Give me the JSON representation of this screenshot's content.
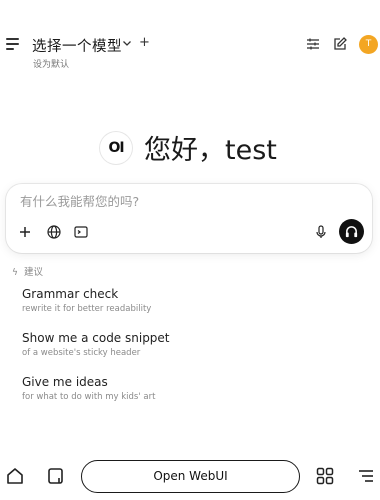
{
  "header": {
    "model_selector_label": "选择一个模型",
    "set_default_label": "设为默认",
    "avatar_initial": "T"
  },
  "greeting": {
    "logo_text": "OI",
    "text": "您好，test"
  },
  "composer": {
    "placeholder": "有什么我能帮您的吗?"
  },
  "suggestions": {
    "header": "建议",
    "items": [
      {
        "title": "Grammar check",
        "subtitle": "rewrite it for better readability"
      },
      {
        "title": "Show me a code snippet",
        "subtitle": "of a website's sticky header"
      },
      {
        "title": "Give me ideas",
        "subtitle": "for what to do with my kids' art"
      }
    ]
  },
  "bottombar": {
    "open_webui_label": "Open WebUI"
  },
  "colors": {
    "avatar": "#f3a623",
    "voice_button": "#111111"
  }
}
